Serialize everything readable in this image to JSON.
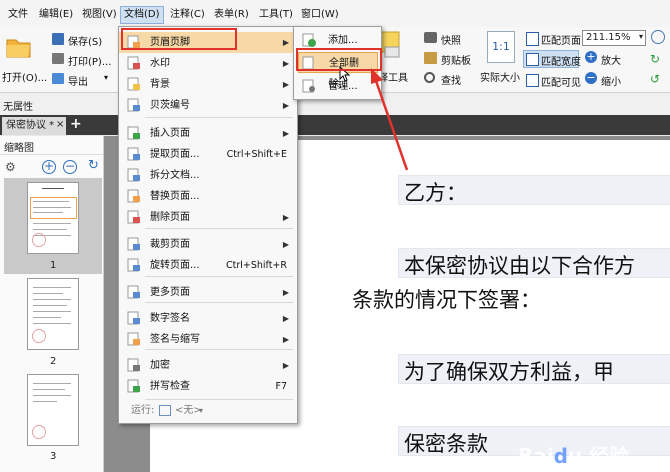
{
  "menubar": {
    "items": [
      "文件",
      "编辑(E)",
      "视图(V)",
      "文档(D)",
      "注释(C)",
      "表单(R)",
      "工具(T)",
      "窗口(W)"
    ]
  },
  "ribbon": {
    "open_label": "打开(O)...",
    "save_label": "保存(S)",
    "print_label": "打印(P)...",
    "export_label": "导出",
    "add_watermark_label": "注释工具",
    "snapshot_label": "快照",
    "clipboard_label": "剪贴板",
    "find_label": "查找",
    "actual_size_label": "实际大小",
    "fit_page_label": "匹配页面",
    "fit_width_label": "匹配宽度",
    "fit_visible_label": "匹配可见",
    "zoom_value": "211.15%",
    "zoom_in_label": "放大",
    "zoom_out_label": "缩小",
    "actual_size_glyph": "1:1"
  },
  "property_bar": {
    "label": "无属性"
  },
  "tabs": {
    "doc_tab": "保密协议 *",
    "close": "×",
    "add": "+"
  },
  "thumbnails": {
    "title": "缩略图",
    "pages": [
      "1",
      "2",
      "3"
    ]
  },
  "document": {
    "line1": "乙方：",
    "line2": "本保密协议由以下合作方",
    "line3": "条款的情况下签署：",
    "line4": "为了确保双方利益，甲",
    "line5": "保密条款"
  },
  "doc_menu": {
    "items": [
      {
        "label": "页眉页脚",
        "shortcut": "",
        "submenu": true
      },
      {
        "label": "水印",
        "shortcut": "",
        "submenu": true
      },
      {
        "label": "背景",
        "shortcut": "",
        "submenu": true
      },
      {
        "label": "贝茨编号",
        "shortcut": "",
        "submenu": true
      },
      {
        "label": "插入页面",
        "shortcut": "",
        "submenu": true
      },
      {
        "label": "提取页面...",
        "shortcut": "Ctrl+Shift+E",
        "submenu": false
      },
      {
        "label": "拆分文档...",
        "shortcut": "",
        "submenu": false
      },
      {
        "label": "替换页面...",
        "shortcut": "",
        "submenu": false
      },
      {
        "label": "删除页面",
        "shortcut": "",
        "submenu": true
      },
      {
        "label": "裁剪页面",
        "shortcut": "",
        "submenu": true
      },
      {
        "label": "旋转页面...",
        "shortcut": "Ctrl+Shift+R",
        "submenu": false
      },
      {
        "label": "更多页面",
        "shortcut": "",
        "submenu": true
      },
      {
        "label": "数字签名",
        "shortcut": "",
        "submenu": true
      },
      {
        "label": "签名与缩写",
        "shortcut": "",
        "submenu": true
      },
      {
        "label": "加密",
        "shortcut": "",
        "submenu": true
      },
      {
        "label": "拼写检查",
        "shortcut": "F7",
        "submenu": false
      }
    ],
    "run_label": "运行:",
    "run_value": "<无>"
  },
  "header_footer_submenu": {
    "items": [
      "添加...",
      "全部删除...",
      "管理..."
    ]
  },
  "colors": {
    "highlight_red": "#e0312b",
    "menu_hover": "#f7d9a8"
  }
}
